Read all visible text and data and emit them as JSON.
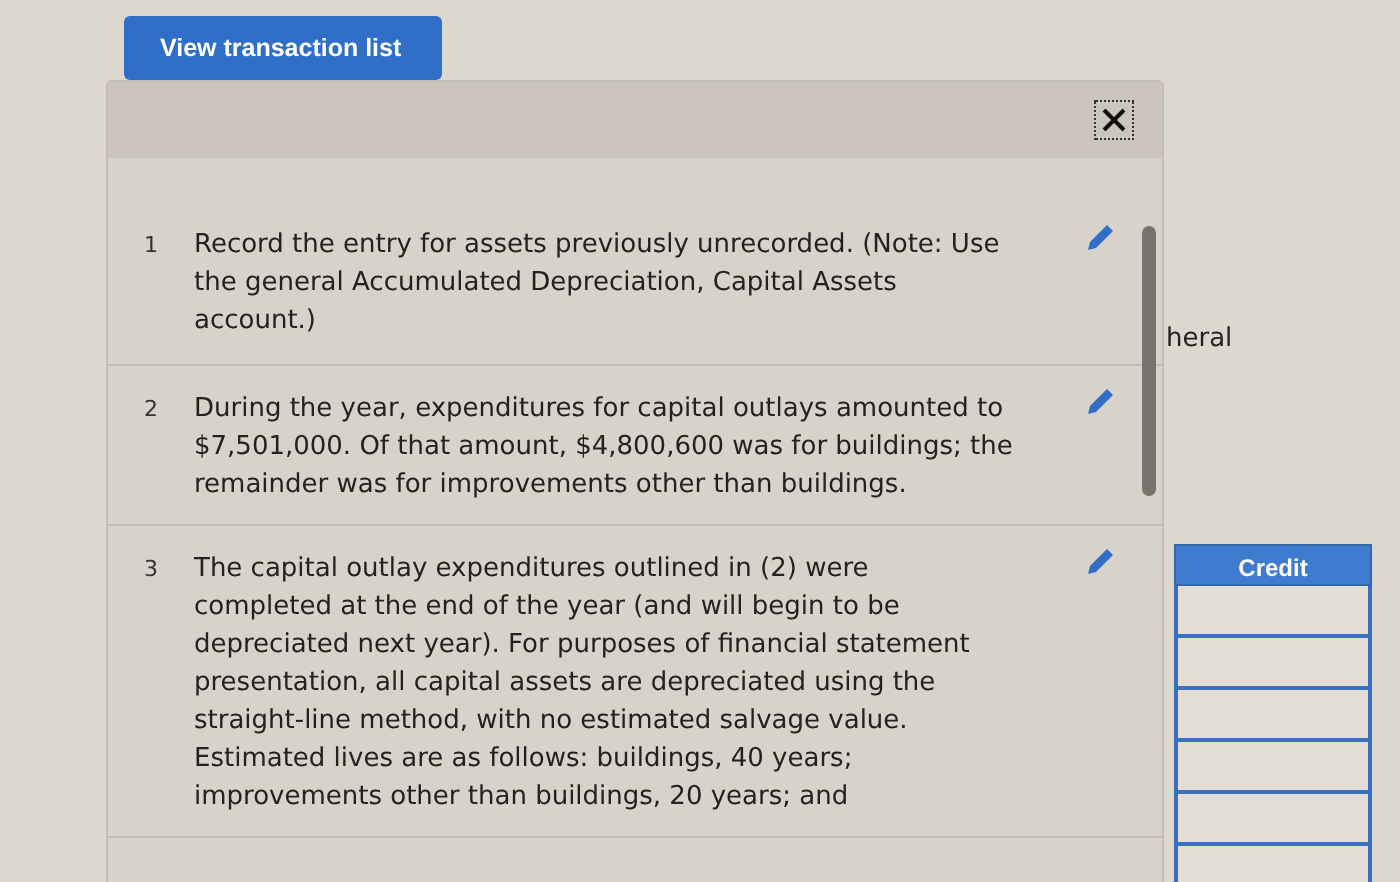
{
  "transaction_list_button": {
    "label": "View transaction list"
  },
  "transactions": [
    {
      "number": "1",
      "text": "Record the entry for assets previously unrecorded. (Note: Use the general Accumulated Depreciation, Capital Assets account.)"
    },
    {
      "number": "2",
      "text": "During the year, expenditures for capital outlays amounted to $7,501,000. Of that amount, $4,800,600 was for buildings; the remainder was for improvements other than buildings."
    },
    {
      "number": "3",
      "text": "The capital outlay expenditures outlined in (2) were completed at the end of the year (and will begin to be depreciated next year). For purposes of financial statement presentation, all capital assets are depreciated using the straight-line method, with no estimated salvage value. Estimated lives are as follows: buildings, 40 years; improvements other than buildings, 20 years; and"
    }
  ],
  "background_sheet": {
    "fragment": "heral",
    "credit_column": {
      "header": "Credit",
      "cells": [
        {
          "kind": "field"
        },
        {
          "kind": "field"
        },
        {
          "kind": "field"
        },
        {
          "kind": "field"
        },
        {
          "kind": "field"
        },
        {
          "kind": "field"
        }
      ]
    }
  }
}
